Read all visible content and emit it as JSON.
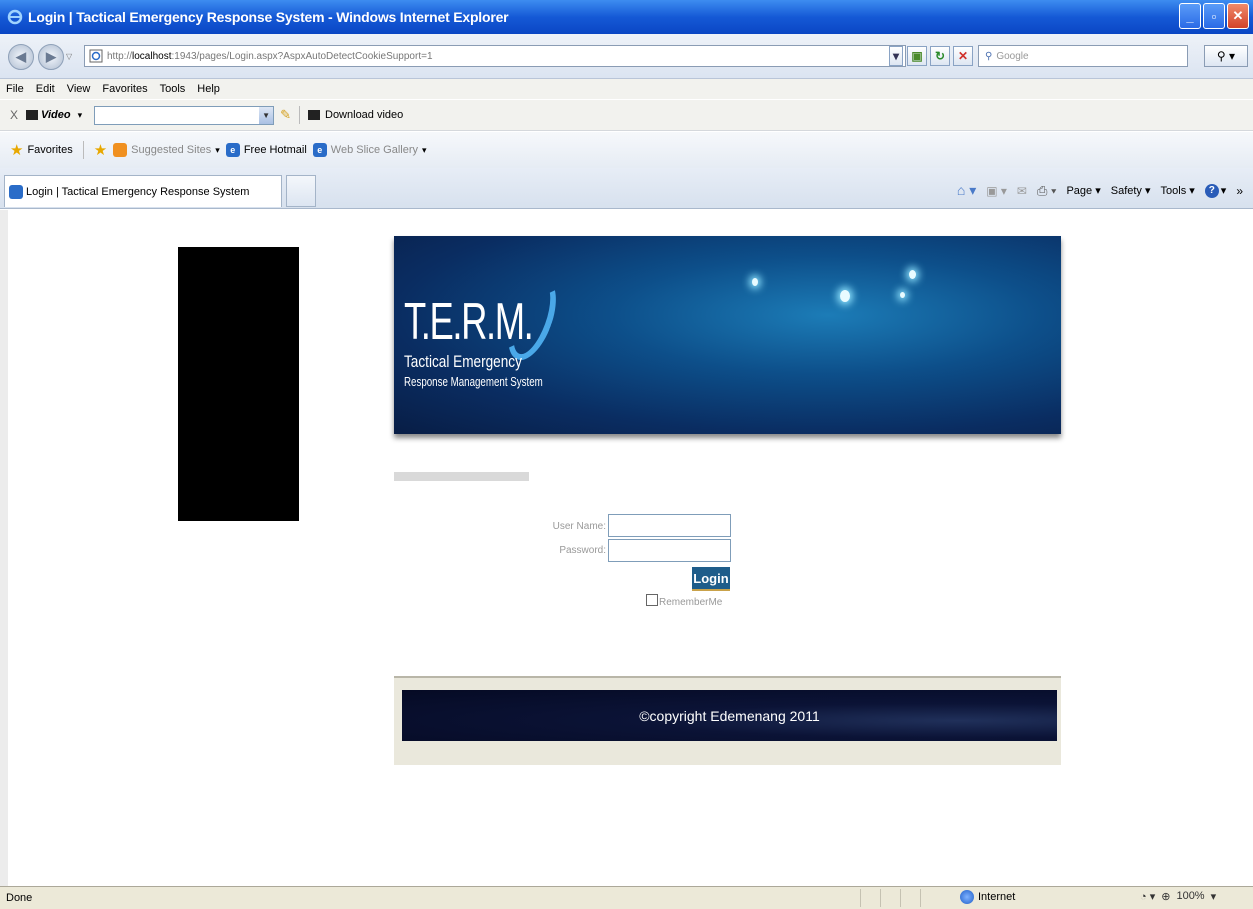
{
  "window": {
    "title": "Login | Tactical Emergency Response System - Windows Internet Explorer"
  },
  "address": {
    "url_prefix": "http://",
    "url_host": "localhost",
    "url_rest": ":1943/pages/Login.aspx?AspxAutoDetectCookieSupport=1",
    "search_placeholder": "Google"
  },
  "menu": [
    "File",
    "Edit",
    "View",
    "Favorites",
    "Tools",
    "Help"
  ],
  "video_toolbar": {
    "close": "X",
    "logo": "Video",
    "download": "Download video"
  },
  "favorites_bar": {
    "favorites": "Favorites",
    "suggested": "Suggested Sites",
    "hotmail": "Free Hotmail",
    "gallery": "Web Slice Gallery"
  },
  "tab": {
    "label": "Login | Tactical Emergency Response System"
  },
  "command_bar": {
    "page": "Page",
    "safety": "Safety",
    "tools": "Tools"
  },
  "banner": {
    "logo": "T.E.R.M.",
    "line1": "Tactical Emergency",
    "line2": "Response Management System"
  },
  "login_form": {
    "username_label": "User Name:",
    "password_label": "Password:",
    "username_value": "",
    "password_value": "",
    "login_button": "Login",
    "remember_label": "RememberMe",
    "remember_checked": false
  },
  "footer": {
    "copyright": "©copyright Edemenang 2011"
  },
  "status": {
    "text": "Done",
    "zone": "Internet",
    "zoom": "100%"
  },
  "colors": {
    "titlebar": "#1559d6",
    "banner": "#0a2d62",
    "login_button": "#1f5d8a",
    "footer": "#050a24"
  }
}
